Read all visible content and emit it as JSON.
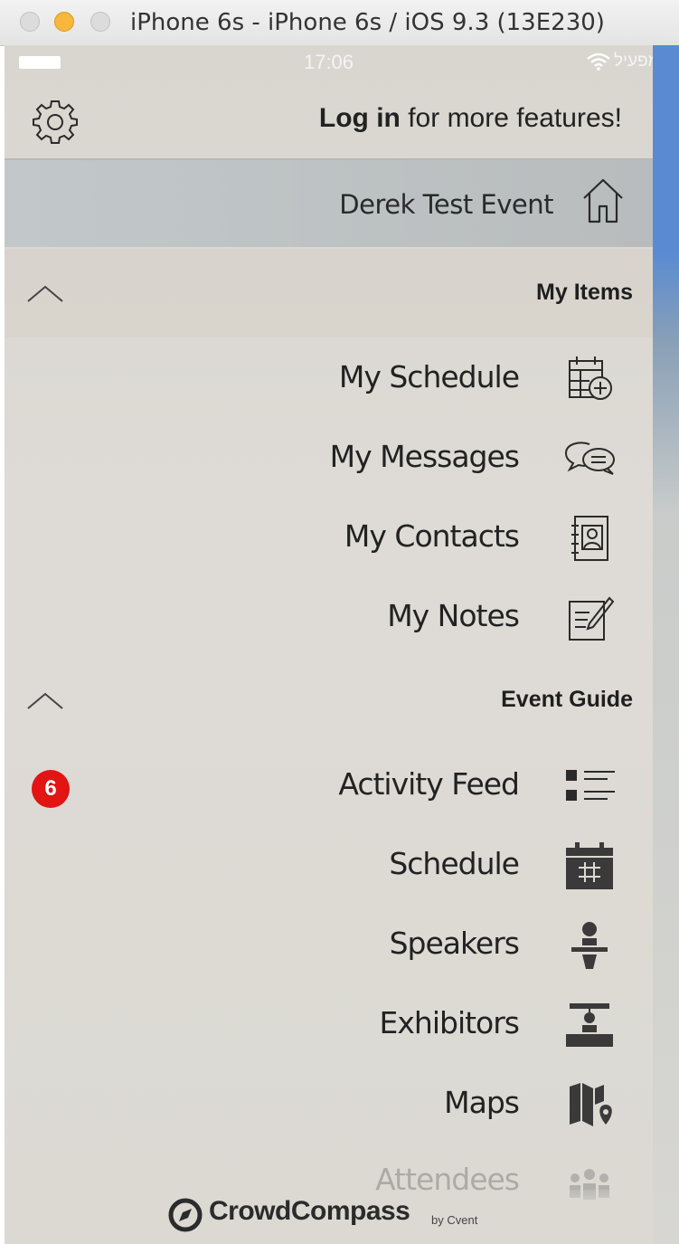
{
  "window": {
    "title": "iPhone 6s - iPhone 6s / iOS 9.3 (13E230)"
  },
  "status_bar": {
    "time": "17:06",
    "carrier": "מפעיל"
  },
  "header": {
    "login_bold": "Log in",
    "login_rest": " for more features!"
  },
  "event": {
    "name": "Derek Test Event"
  },
  "sections": {
    "my_items": {
      "title": "My Items",
      "items": [
        {
          "label": "My Schedule",
          "icon": "calendar-add-icon"
        },
        {
          "label": "My Messages",
          "icon": "chat-bubbles-icon"
        },
        {
          "label": "My Contacts",
          "icon": "address-book-icon"
        },
        {
          "label": "My Notes",
          "icon": "notes-icon"
        }
      ]
    },
    "event_guide": {
      "title": "Event Guide",
      "items": [
        {
          "label": "Activity Feed",
          "icon": "activity-list-icon",
          "badge": "6"
        },
        {
          "label": "Schedule",
          "icon": "calendar-icon"
        },
        {
          "label": "Speakers",
          "icon": "speaker-podium-icon"
        },
        {
          "label": "Exhibitors",
          "icon": "exhibitor-booth-icon"
        },
        {
          "label": "Maps",
          "icon": "map-pin-icon"
        },
        {
          "label": "Attendees",
          "icon": "attendees-icon"
        }
      ]
    }
  },
  "footer": {
    "brand": "CrowdCompass",
    "by": "by Cvent"
  },
  "colors": {
    "badge": "#e21414",
    "drawer_bg": "#dcd9d3",
    "event_row_bg": "#bfc4c6"
  }
}
